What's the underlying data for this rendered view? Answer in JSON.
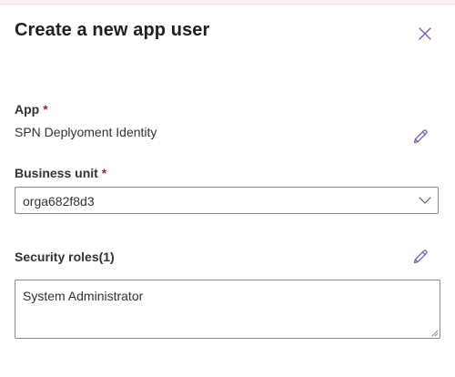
{
  "panel": {
    "title": "Create a new app user",
    "close_icon": "close-icon"
  },
  "app_field": {
    "label": "App",
    "required_marker": "*",
    "value": "SPN Deplyoment Identity",
    "edit_icon": "pencil-icon"
  },
  "business_unit_field": {
    "label": "Business unit",
    "required_marker": "*",
    "selected_value": "orga682f8d3",
    "chevron_icon": "chevron-down-icon"
  },
  "security_roles_field": {
    "label": "Security roles(1)",
    "value": "System Administrator",
    "edit_icon": "pencil-icon"
  },
  "colors": {
    "accent": "#8764b8",
    "required": "#a4262c",
    "border": "#8a8886",
    "text": "#323130"
  }
}
